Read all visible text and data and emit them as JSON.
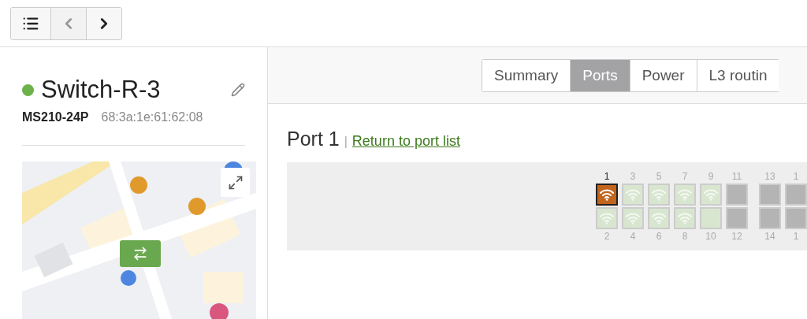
{
  "toolbar": {
    "buttons": [
      {
        "kind": "list",
        "disabled": false
      },
      {
        "kind": "prev",
        "disabled": true
      },
      {
        "kind": "next",
        "disabled": false
      }
    ]
  },
  "device": {
    "name": "Switch-R-3",
    "online": true,
    "model": "MS210-24P",
    "mac": "68:3a:1e:61:62:08"
  },
  "tabs": [
    {
      "label": "Summary",
      "selected": false
    },
    {
      "label": "Ports",
      "selected": true
    },
    {
      "label": "Power",
      "selected": false
    },
    {
      "label": "L3 routin",
      "selected": false
    }
  ],
  "port_view": {
    "title": "Port 1",
    "separator": "|",
    "link": "Return to port list",
    "groups": [
      {
        "columns": [
          {
            "top": {
              "label": "1",
              "kind": "connected",
              "selected": true
            },
            "bottom": {
              "label": "2",
              "kind": "connected",
              "selected": false
            }
          },
          {
            "top": {
              "label": "3",
              "kind": "connected",
              "selected": false
            },
            "bottom": {
              "label": "4",
              "kind": "connected",
              "selected": false
            }
          },
          {
            "top": {
              "label": "5",
              "kind": "connected",
              "selected": false
            },
            "bottom": {
              "label": "6",
              "kind": "connected",
              "selected": false
            }
          },
          {
            "top": {
              "label": "7",
              "kind": "connected",
              "selected": false
            },
            "bottom": {
              "label": "8",
              "kind": "connected",
              "selected": false
            }
          },
          {
            "top": {
              "label": "9",
              "kind": "connected",
              "selected": false
            },
            "bottom": {
              "label": "10",
              "kind": "idle",
              "selected": false
            }
          },
          {
            "top": {
              "label": "11",
              "kind": "disabled",
              "selected": false
            },
            "bottom": {
              "label": "12",
              "kind": "disabled",
              "selected": false
            }
          }
        ]
      },
      {
        "columns": [
          {
            "top": {
              "label": "13",
              "kind": "disabled",
              "selected": false
            },
            "bottom": {
              "label": "14",
              "kind": "disabled",
              "selected": false
            }
          },
          {
            "top": {
              "label": "1",
              "kind": "disabled",
              "selected": false
            },
            "bottom": {
              "label": "1",
              "kind": "disabled",
              "selected": false
            }
          }
        ]
      }
    ]
  }
}
